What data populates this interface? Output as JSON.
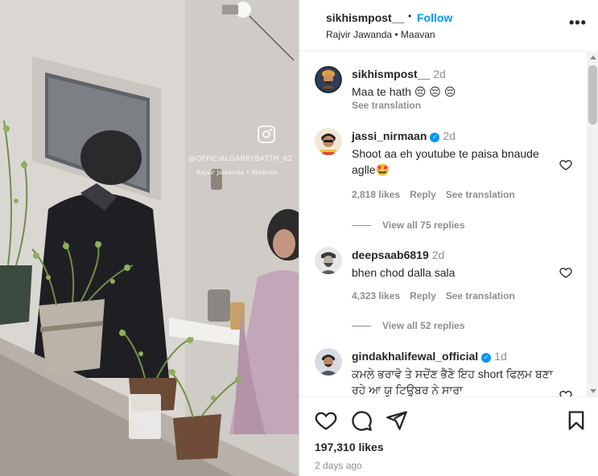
{
  "media": {
    "watermark_handle": "@OFFICIALGARRYBATTH_62",
    "watermark_audio": "Rajvir Jawanda • Maavan",
    "watermark_icon": "instagram-icon"
  },
  "header": {
    "username": "sikhismpost__",
    "separator": "•",
    "follow_label": "Follow",
    "audio": "Rajvir Jawanda • Maavan",
    "more_label": "•••",
    "accent_color": "#0095f6"
  },
  "comments": [
    {
      "username": "sikhismpost__",
      "time": "2d",
      "verified": false,
      "text": "Maa te hath 😔 😔 😔",
      "see_translation": "See translation"
    },
    {
      "username": "jassi_nirmaan",
      "time": "2d",
      "verified": true,
      "text": "Shoot aa eh youtube te paisa bnaude aglle🤩",
      "likes": "2,818 likes",
      "reply": "Reply",
      "see_translation": "See translation",
      "view_replies": "View all 75 replies"
    },
    {
      "username": "deepsaab6819",
      "time": "2d",
      "verified": false,
      "text": "bhen chod dalla sala",
      "likes": "4,323 likes",
      "reply": "Reply",
      "see_translation": "See translation",
      "view_replies": "View all 52 replies"
    },
    {
      "username": "gindakhalifewal_official",
      "time": "1d",
      "verified": true,
      "text": "ਕਮਲੇ ਭਰਾਵੋ ਤੇ ਸਦੋਂਣ ਭੈਣੋ ਇਹ short ਫਿਲਮ ਬਣਾ ਰਹੇ ਆ ਯੂ ਟਿਊਬਰ ਨੇ ਸਾਰਾ"
    }
  ],
  "actions": {
    "like_icon": "heart-icon",
    "comment_icon": "comment-icon",
    "share_icon": "share-icon",
    "save_icon": "bookmark-icon",
    "likes": "197,310 likes",
    "date": "2 days ago"
  }
}
